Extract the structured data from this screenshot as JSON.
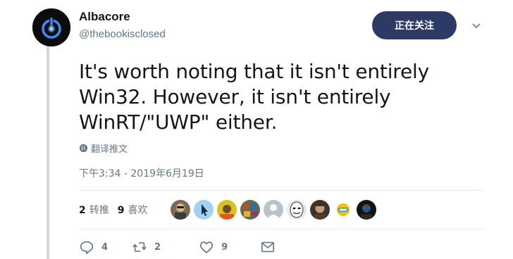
{
  "author": {
    "name": "Albacore",
    "handle": "@thebookisclosed"
  },
  "follow_button": {
    "label": "正在关注"
  },
  "tweet": {
    "lines": [
      "It's worth noting that it isn't entirely",
      "Win32. However, it isn't entirely",
      "WinRT/\"UWP\" either."
    ]
  },
  "translate": {
    "label": "翻译推文",
    "icon": "globe-icon"
  },
  "timestamp": "下午3:34 - 2019年6月19日",
  "stats": {
    "retweets": {
      "count": "2",
      "label": "转推"
    },
    "likes": {
      "count": "9",
      "label": "喜欢"
    }
  },
  "likers_count_shown": 9,
  "actions": {
    "reply": {
      "count": "4",
      "icon": "reply-icon"
    },
    "retweet": {
      "count": "2",
      "icon": "retweet-icon"
    },
    "like": {
      "count": "9",
      "icon": "heart-icon"
    },
    "message": {
      "count": "",
      "icon": "envelope-icon"
    }
  },
  "colors": {
    "follow_button_bg": "#2e3a66",
    "muted_text": "#657786",
    "thread_line": "#cfd8e3"
  }
}
